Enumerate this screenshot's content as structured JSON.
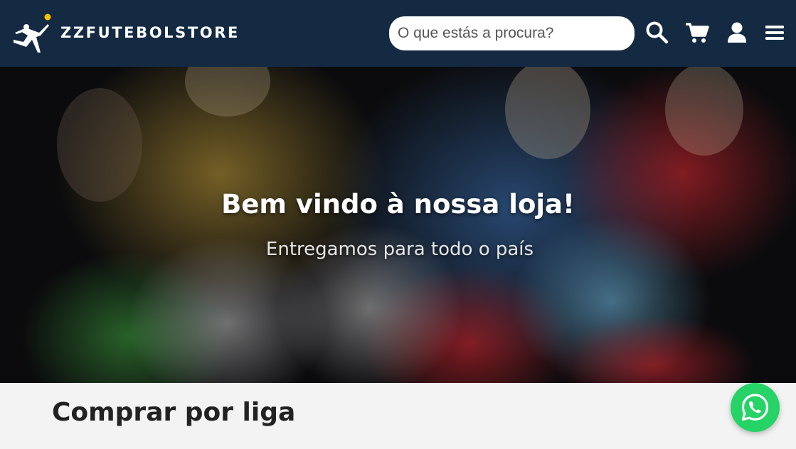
{
  "header": {
    "brand": "ZZFUTEBOLSTORE",
    "search_placeholder": "O que estás a procura?",
    "icons": [
      "search-icon",
      "cart-icon",
      "user-icon",
      "menu-icon"
    ]
  },
  "hero": {
    "title": "Bem vindo à nossa loja!",
    "subtitle": "Entregamos para todo o país"
  },
  "main": {
    "section_title": "Comprar por liga"
  },
  "colors": {
    "header_bg": "#132a42",
    "whatsapp": "#25d366",
    "page_bg": "#f3f3f3"
  }
}
